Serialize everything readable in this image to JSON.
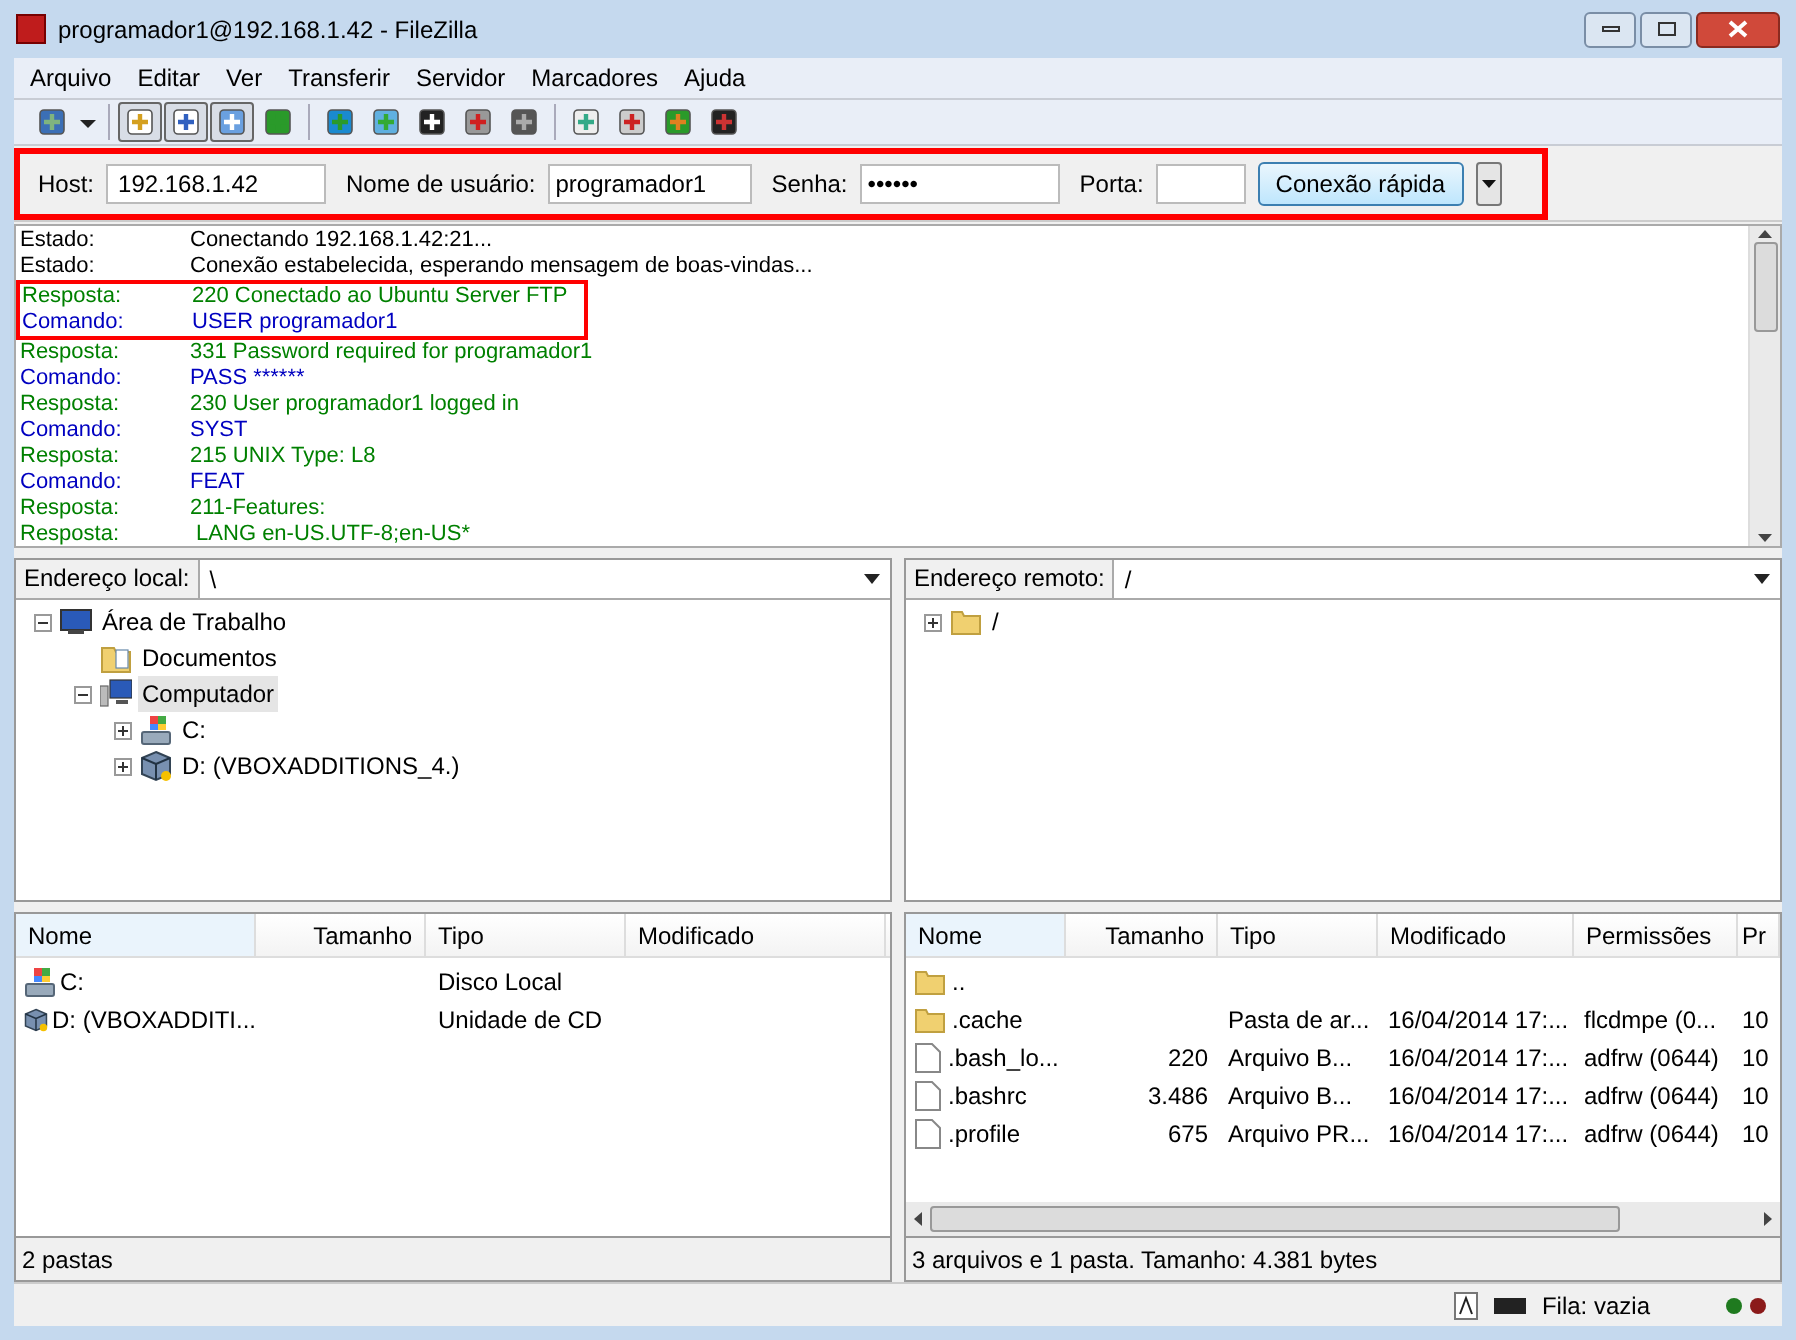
{
  "window": {
    "title": "programador1@192.168.1.42 - FileZilla"
  },
  "menu": [
    "Arquivo",
    "Editar",
    "Ver",
    "Transferir",
    "Servidor",
    "Marcadores",
    "Ajuda"
  ],
  "toolbar": [
    {
      "kind": "sitemanager",
      "pressed": false
    },
    {
      "kind": "dropdown"
    },
    {
      "kind": "sep"
    },
    {
      "kind": "log",
      "pressed": true
    },
    {
      "kind": "tree",
      "pressed": true
    },
    {
      "kind": "remotetree",
      "pressed": true
    },
    {
      "kind": "transfer",
      "pressed": false
    },
    {
      "kind": "sep"
    },
    {
      "kind": "refresh",
      "pressed": false
    },
    {
      "kind": "filter",
      "pressed": false
    },
    {
      "kind": "flag",
      "pressed": false
    },
    {
      "kind": "cancel",
      "pressed": false
    },
    {
      "kind": "check",
      "pressed": false
    },
    {
      "kind": "sep"
    },
    {
      "kind": "list",
      "pressed": false
    },
    {
      "kind": "search",
      "pressed": false
    },
    {
      "kind": "sync",
      "pressed": false
    },
    {
      "kind": "binoculars",
      "pressed": false
    }
  ],
  "quickconnect": {
    "highlighted": true,
    "host_label": "Host:",
    "host": "192.168.1.42",
    "user_label": "Nome de usuário:",
    "user": "programador1",
    "password_label": "Senha:",
    "password": "••••••",
    "port_label": "Porta:",
    "button": "Conexão rápida"
  },
  "log": [
    {
      "kind": "status",
      "highlighted": false,
      "label": "Estado:",
      "text": "Conectando 192.168.1.42:21..."
    },
    {
      "kind": "status",
      "highlighted": false,
      "label": "Estado:",
      "text": "Conexão estabelecida, esperando mensagem de boas-vindas..."
    },
    {
      "kind": "response",
      "highlighted": true,
      "label": "Resposta:",
      "text": "220 Conectado ao Ubuntu Server FTP"
    },
    {
      "kind": "command",
      "highlighted": true,
      "label": "Comando:",
      "text": "USER programador1"
    },
    {
      "kind": "response",
      "highlighted": false,
      "label": "Resposta:",
      "text": "331 Password required for programador1"
    },
    {
      "kind": "command",
      "highlighted": false,
      "label": "Comando:",
      "text": "PASS ******"
    },
    {
      "kind": "response",
      "highlighted": false,
      "label": "Resposta:",
      "text": "230 User programador1 logged in"
    },
    {
      "kind": "command",
      "highlighted": false,
      "label": "Comando:",
      "text": "SYST"
    },
    {
      "kind": "response",
      "highlighted": false,
      "label": "Resposta:",
      "text": "215 UNIX Type: L8"
    },
    {
      "kind": "command",
      "highlighted": false,
      "label": "Comando:",
      "text": "FEAT"
    },
    {
      "kind": "response",
      "highlighted": false,
      "label": "Resposta:",
      "text": "211-Features:"
    },
    {
      "kind": "response",
      "highlighted": false,
      "label": "Resposta:",
      "text": " LANG en-US.UTF-8;en-US*"
    }
  ],
  "local": {
    "address_label": "Endereço local:",
    "address": "\\",
    "tree": [
      {
        "label": "Área de Trabalho",
        "kind": "desktop",
        "expanded": true,
        "selected": false,
        "children": [
          {
            "label": "Documentos",
            "kind": "docs",
            "selected": false
          },
          {
            "label": "Computador",
            "kind": "computer",
            "expanded": true,
            "selected": true,
            "children": [
              {
                "label": "C:",
                "kind": "drive",
                "expanded": false,
                "selected": false
              },
              {
                "label": "D: (VBOXADDITIONS_4.)",
                "kind": "cd",
                "expanded": false,
                "selected": false
              }
            ]
          }
        ]
      }
    ],
    "columns": [
      "Nome",
      "Tamanho",
      "Tipo",
      "Modificado"
    ],
    "rows": [
      {
        "kind": "drive",
        "name": "C:",
        "type": "Disco Local"
      },
      {
        "kind": "cd",
        "name": "D: (VBOXADDITI...",
        "type": "Unidade de CD"
      }
    ],
    "status": "2 pastas"
  },
  "remote": {
    "address_label": "Endereço remoto:",
    "address": "/",
    "tree": [
      {
        "label": "/",
        "kind": "folder",
        "expanded": false,
        "selected": false
      }
    ],
    "columns": [
      "Nome",
      "Tamanho",
      "Tipo",
      "Modificado",
      "Permissões",
      "Pr"
    ],
    "rows": [
      {
        "kind": "folder",
        "cells": [
          ".."
        ]
      },
      {
        "kind": "folder",
        "cells": [
          ".cache",
          "",
          "Pasta de ar...",
          "16/04/2014 17:...",
          "flcdmpe (0...",
          "10"
        ]
      },
      {
        "kind": "file",
        "cells": [
          ".bash_lo...",
          "220",
          "Arquivo B...",
          "16/04/2014 17:...",
          "adfrw (0644)",
          "10"
        ]
      },
      {
        "kind": "file",
        "cells": [
          ".bashrc",
          "3.486",
          "Arquivo B...",
          "16/04/2014 17:...",
          "adfrw (0644)",
          "10"
        ]
      },
      {
        "kind": "file",
        "cells": [
          ".profile",
          "675",
          "Arquivo PR...",
          "16/04/2014 17:...",
          "adfrw (0644)",
          "10"
        ]
      }
    ],
    "status": "3 arquivos e 1 pasta. Tamanho: 4.381 bytes"
  },
  "status_bar": {
    "queue": "Fila: vazia",
    "lights": [
      {
        "color": "#1f7a1f"
      },
      {
        "color": "#8b1a1a"
      }
    ]
  }
}
